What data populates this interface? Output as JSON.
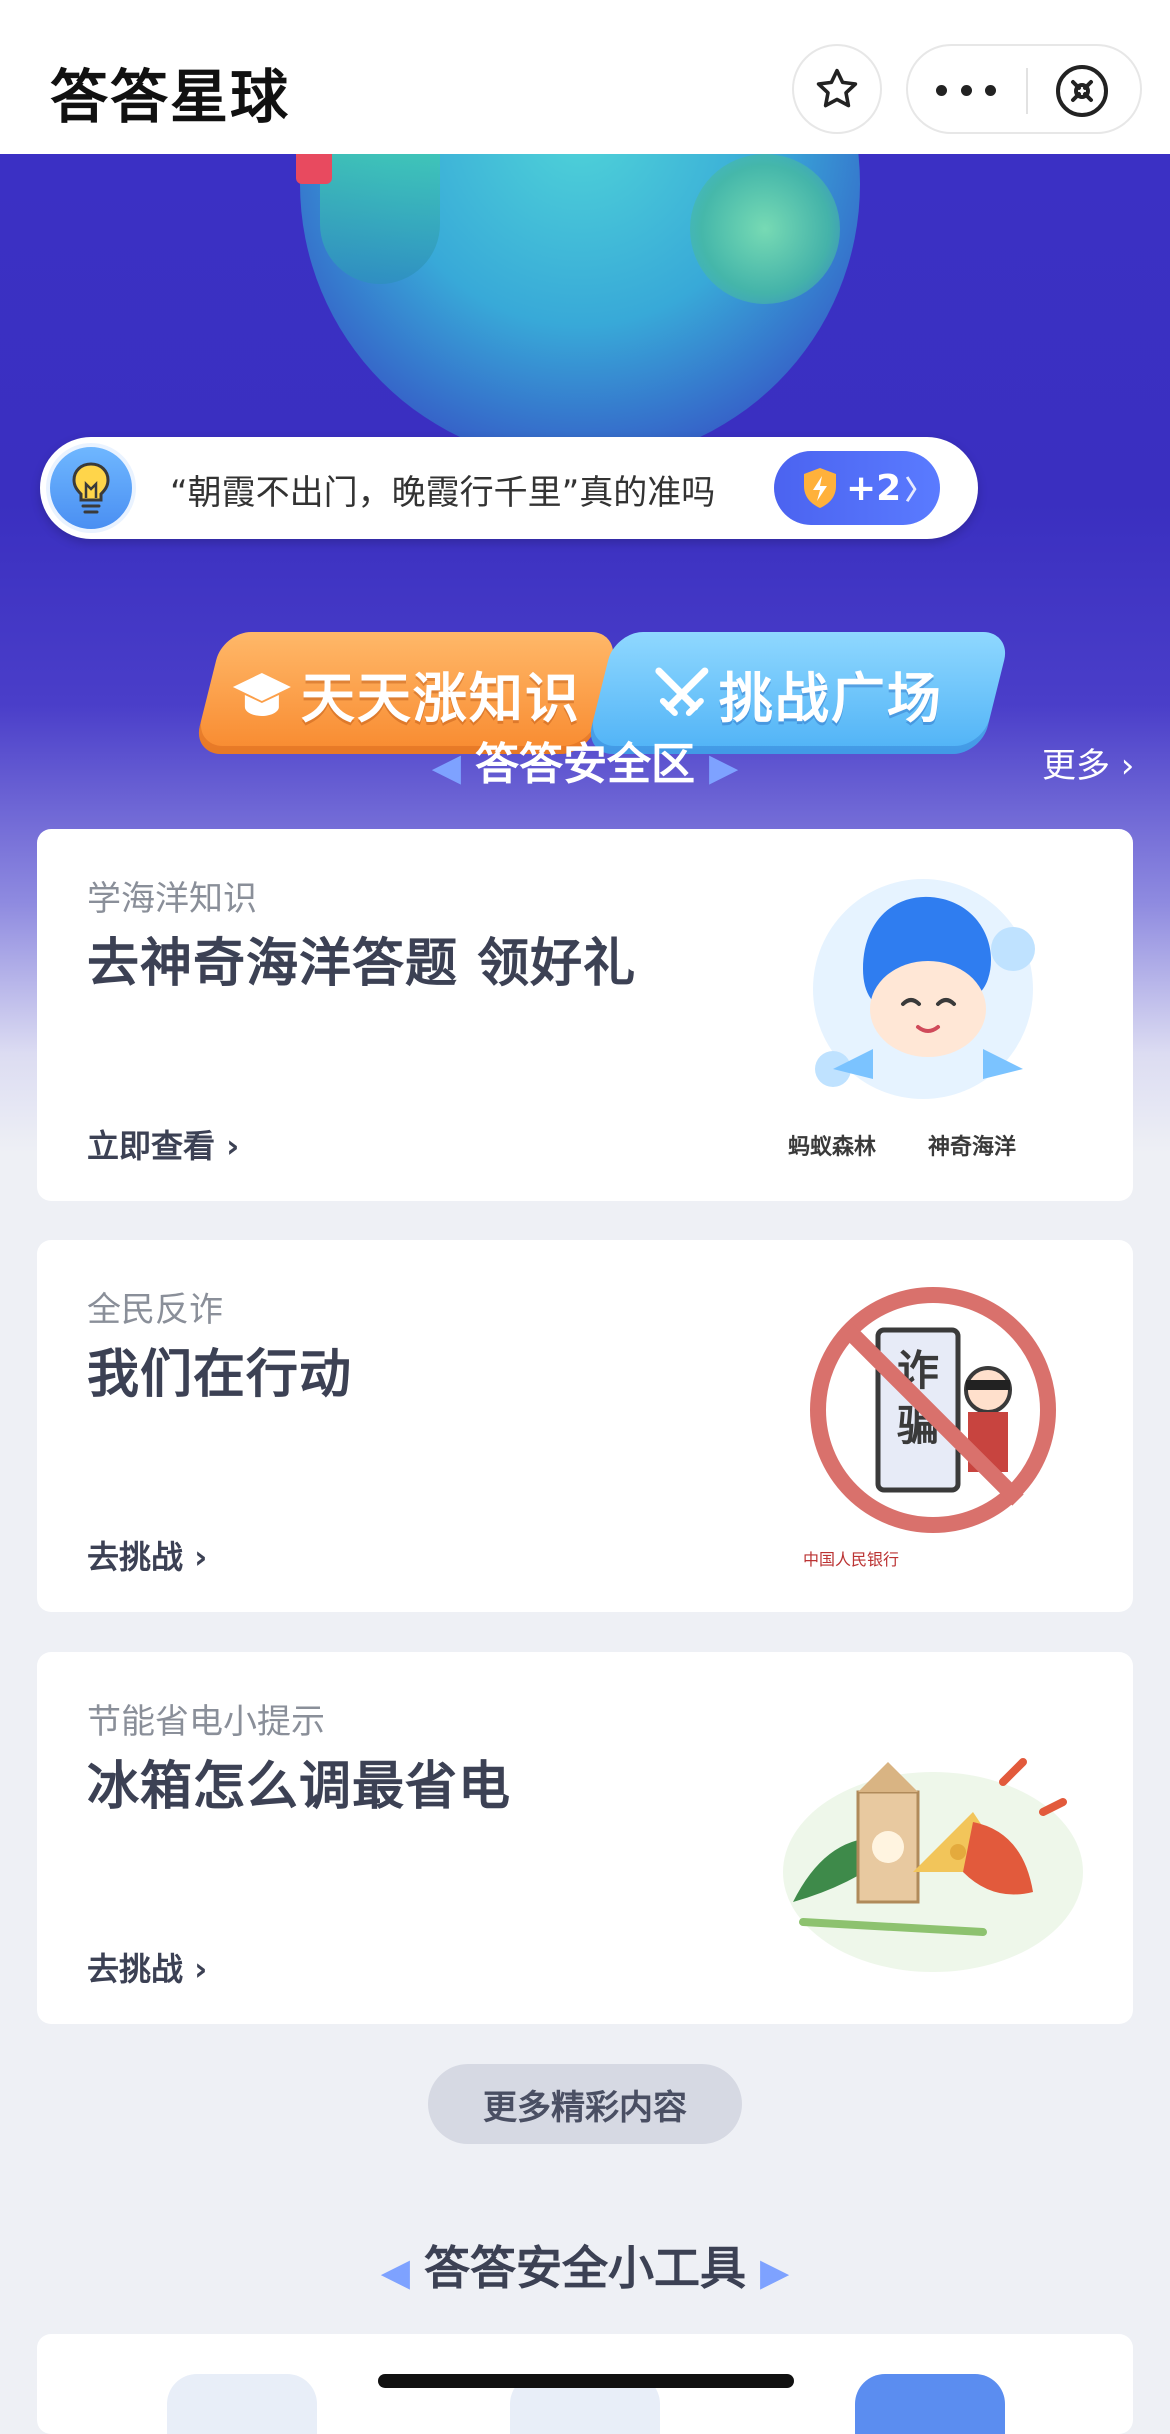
{
  "header": {
    "title": "答答星球"
  },
  "tip": {
    "text": "“朝霞不出门，晚霞行千里”真的准吗",
    "reward": "+2"
  },
  "main_buttons": {
    "daily": "天天涨知识",
    "challenge": "挑战广场"
  },
  "safety_zone": {
    "title": "答答安全区",
    "more": "更多"
  },
  "cards": [
    {
      "subtitle": "学海洋知识",
      "title": "去神奇海洋答题 领好礼",
      "action": "立即查看",
      "brand_left": "蚂蚁森林",
      "brand_right": "神奇海洋"
    },
    {
      "subtitle": "全民反诈",
      "title": "我们在行动",
      "action": "去挑战",
      "illus_text": "诈骗",
      "brand": "中国人民银行"
    },
    {
      "subtitle": "节能省电小提示",
      "title": "冰箱怎么调最省电",
      "action": "去挑战"
    }
  ],
  "more_content": "更多精彩内容",
  "tools": {
    "title": "答答安全小工具"
  },
  "colors": {
    "hero_purple": "#3b30c4",
    "accent_blue": "#4b63f0",
    "orange": "#f88a2f",
    "card_title": "#3c4154"
  }
}
